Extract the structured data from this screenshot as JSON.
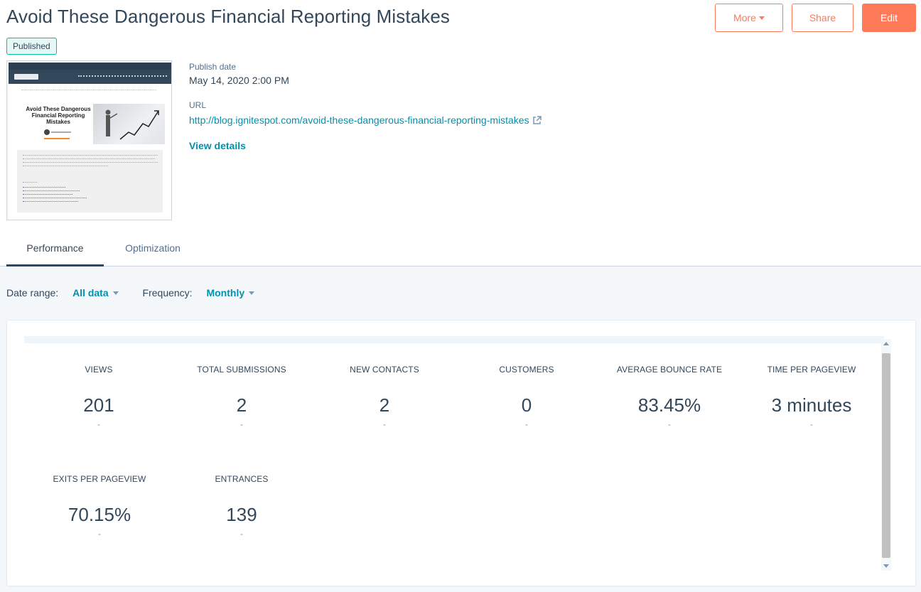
{
  "header": {
    "title": "Avoid These Dangerous Financial Reporting Mistakes",
    "status": "Published",
    "buttons": {
      "more": "More",
      "share": "Share",
      "edit": "Edit"
    }
  },
  "preview": {
    "heading": "Avoid These Dangerous Financial Reporting Mistakes"
  },
  "details": {
    "publish_date_label": "Publish date",
    "publish_date": "May 14, 2020 2:00 PM",
    "url_label": "URL",
    "url": "http://blog.ignitespot.com/avoid-these-dangerous-financial-reporting-mistakes",
    "view_details": "View details"
  },
  "tabs": [
    {
      "label": "Performance",
      "active": true
    },
    {
      "label": "Optimization",
      "active": false
    }
  ],
  "filters": {
    "date_range_label": "Date range:",
    "date_range_value": "All data",
    "frequency_label": "Frequency:",
    "frequency_value": "Monthly"
  },
  "metrics": [
    {
      "label": "VIEWS",
      "value": "201",
      "change": "-"
    },
    {
      "label": "TOTAL SUBMISSIONS",
      "value": "2",
      "change": "-"
    },
    {
      "label": "NEW CONTACTS",
      "value": "2",
      "change": "-"
    },
    {
      "label": "CUSTOMERS",
      "value": "0",
      "change": "-"
    },
    {
      "label": "AVERAGE BOUNCE RATE",
      "value": "83.45%",
      "change": "-"
    },
    {
      "label": "TIME PER PAGEVIEW",
      "value": "3 minutes",
      "change": "-"
    },
    {
      "label": "EXITS PER PAGEVIEW",
      "value": "70.15%",
      "change": "-"
    },
    {
      "label": "ENTRANCES",
      "value": "139",
      "change": "-"
    }
  ],
  "icons": {
    "more_caret": "caret-down-icon",
    "url_external": "external-link-icon",
    "filter_caret": "caret-down-icon"
  },
  "colors": {
    "accent": "#ff7a59",
    "link": "#0091ae",
    "text": "#33475b",
    "badge_border": "#00bda5",
    "badge_bg": "#e5f8f6"
  }
}
